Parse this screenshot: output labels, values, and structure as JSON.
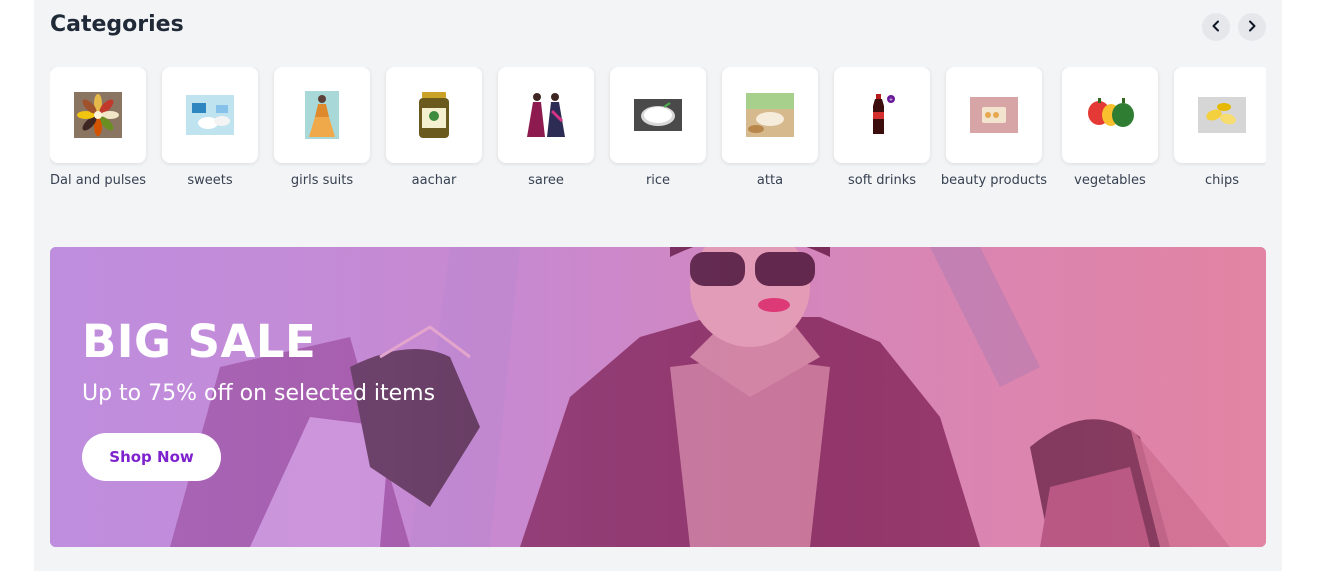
{
  "categories": {
    "title": "Categories",
    "prev_icon": "chevron-left-icon",
    "next_icon": "chevron-right-icon",
    "items": [
      {
        "label": "Dal and pulses",
        "icon": "dal-and-pulses-image"
      },
      {
        "label": "sweets",
        "icon": "sweets-image"
      },
      {
        "label": "girls suits",
        "icon": "girls-suits-image"
      },
      {
        "label": "aachar",
        "icon": "aachar-image"
      },
      {
        "label": "saree",
        "icon": "saree-image"
      },
      {
        "label": "rice",
        "icon": "rice-image"
      },
      {
        "label": "atta",
        "icon": "atta-image"
      },
      {
        "label": "soft drinks",
        "icon": "soft-drinks-image"
      },
      {
        "label": "beauty products",
        "icon": "beauty-products-image"
      },
      {
        "label": "vegetables",
        "icon": "vegetables-image"
      },
      {
        "label": "chips",
        "icon": "chips-image"
      }
    ]
  },
  "banner": {
    "title": "BIG SALE",
    "subtitle": "Up to 75% off on selected items",
    "button_label": "Shop Now",
    "accent_color": "#7e22ce"
  }
}
